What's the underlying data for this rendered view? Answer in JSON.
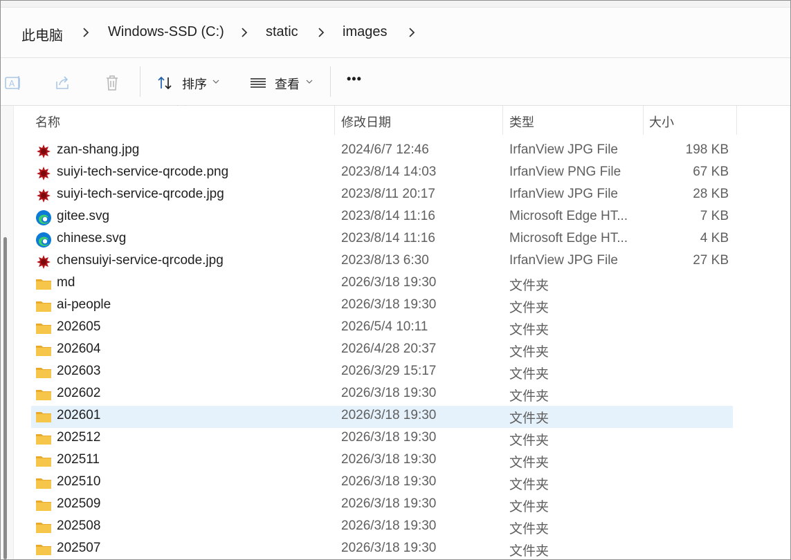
{
  "breadcrumb": [
    "此电脑",
    "Windows-SSD (C:)",
    "static",
    "images"
  ],
  "toolbar": {
    "sort_label": "排序",
    "view_label": "查看",
    "more_label": "•••"
  },
  "columns": {
    "name": "名称",
    "date": "修改日期",
    "type": "类型",
    "size": "大小"
  },
  "files": [
    {
      "name": "zan-shang.jpg",
      "date": "2024/6/7 12:46",
      "type": "IrfanView JPG File",
      "size": "198 KB",
      "icon": "irfanview-icon"
    },
    {
      "name": "suiyi-tech-service-qrcode.png",
      "date": "2023/8/14 14:03",
      "type": "IrfanView PNG File",
      "size": "67 KB",
      "icon": "irfanview-icon"
    },
    {
      "name": "suiyi-tech-service-qrcode.jpg",
      "date": "2023/8/11 20:17",
      "type": "IrfanView JPG File",
      "size": "28 KB",
      "icon": "irfanview-icon"
    },
    {
      "name": "gitee.svg",
      "date": "2023/8/14 11:16",
      "type": "Microsoft Edge HT...",
      "size": "7 KB",
      "icon": "edge-icon"
    },
    {
      "name": "chinese.svg",
      "date": "2023/8/14 11:16",
      "type": "Microsoft Edge HT...",
      "size": "4 KB",
      "icon": "edge-icon"
    },
    {
      "name": "chensuiyi-service-qrcode.jpg",
      "date": "2023/8/13 6:30",
      "type": "IrfanView JPG File",
      "size": "27 KB",
      "icon": "irfanview-icon"
    },
    {
      "name": "md",
      "date": "2026/3/18 19:30",
      "type": "文件夹",
      "size": "",
      "icon": "folder-icon"
    },
    {
      "name": "ai-people",
      "date": "2026/3/18 19:30",
      "type": "文件夹",
      "size": "",
      "icon": "folder-icon"
    },
    {
      "name": "202605",
      "date": "2026/5/4 10:11",
      "type": "文件夹",
      "size": "",
      "icon": "folder-icon"
    },
    {
      "name": "202604",
      "date": "2026/4/28 20:37",
      "type": "文件夹",
      "size": "",
      "icon": "folder-icon"
    },
    {
      "name": "202603",
      "date": "2026/3/29 15:17",
      "type": "文件夹",
      "size": "",
      "icon": "folder-icon"
    },
    {
      "name": "202602",
      "date": "2026/3/18 19:30",
      "type": "文件夹",
      "size": "",
      "icon": "folder-icon"
    },
    {
      "name": "202601",
      "date": "2026/3/18 19:30",
      "type": "文件夹",
      "size": "",
      "icon": "folder-icon",
      "selected": true
    },
    {
      "name": "202512",
      "date": "2026/3/18 19:30",
      "type": "文件夹",
      "size": "",
      "icon": "folder-icon"
    },
    {
      "name": "202511",
      "date": "2026/3/18 19:30",
      "type": "文件夹",
      "size": "",
      "icon": "folder-icon"
    },
    {
      "name": "202510",
      "date": "2026/3/18 19:30",
      "type": "文件夹",
      "size": "",
      "icon": "folder-icon"
    },
    {
      "name": "202509",
      "date": "2026/3/18 19:30",
      "type": "文件夹",
      "size": "",
      "icon": "folder-icon"
    },
    {
      "name": "202508",
      "date": "2026/3/18 19:30",
      "type": "文件夹",
      "size": "",
      "icon": "folder-icon"
    },
    {
      "name": "202507",
      "date": "2026/3/18 19:30",
      "type": "文件夹",
      "size": "",
      "icon": "folder-icon"
    }
  ],
  "colors": {
    "selection": "#e5f1fb",
    "folder": "#f6c64a",
    "accent": "#0067c0"
  }
}
